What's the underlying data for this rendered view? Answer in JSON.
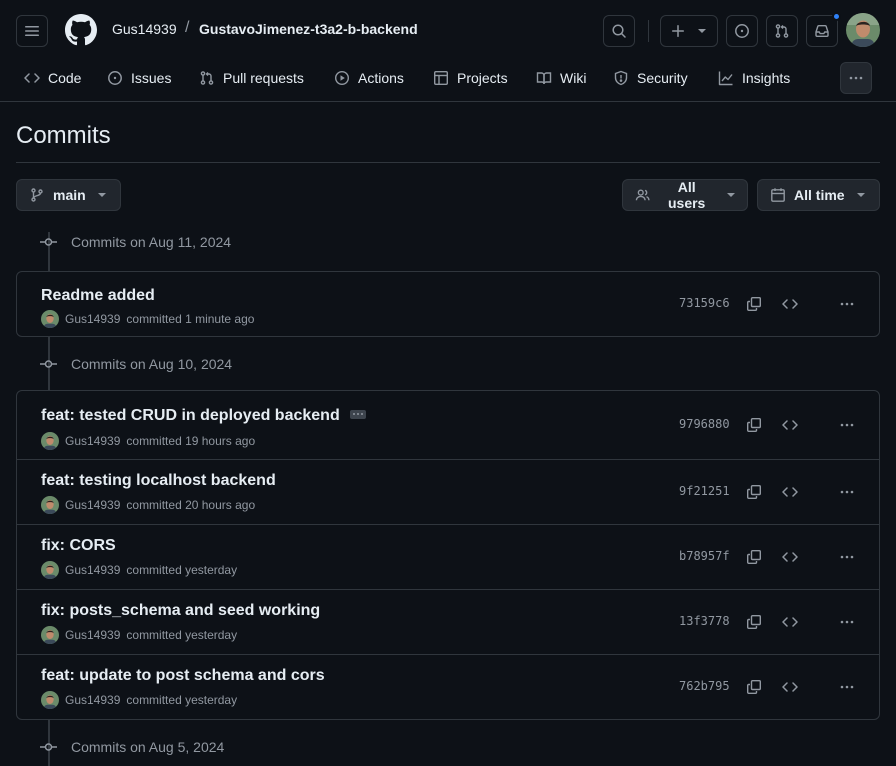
{
  "header": {
    "owner": "Gus14939",
    "separator": "/",
    "repo": "GustavoJimenez-t3a2-b-backend"
  },
  "nav": {
    "tabs": [
      {
        "label": "Code",
        "icon": "code-icon"
      },
      {
        "label": "Issues",
        "icon": "issue-opened-icon"
      },
      {
        "label": "Pull requests",
        "icon": "git-pull-request-icon"
      },
      {
        "label": "Actions",
        "icon": "play-icon"
      },
      {
        "label": "Projects",
        "icon": "table-icon"
      },
      {
        "label": "Wiki",
        "icon": "book-icon"
      },
      {
        "label": "Security",
        "icon": "shield-icon"
      },
      {
        "label": "Insights",
        "icon": "graph-icon"
      }
    ]
  },
  "page": {
    "title": "Commits"
  },
  "filters": {
    "branch": "main",
    "users": "All users",
    "time": "All time"
  },
  "groups": [
    {
      "heading": "Commits on Aug 11, 2024",
      "commits": [
        {
          "message": "Readme added",
          "author": "Gus14939",
          "when": "committed 1 minute ago",
          "sha": "73159c6"
        }
      ]
    },
    {
      "heading": "Commits on Aug 10, 2024",
      "commits": [
        {
          "message": "feat: tested CRUD in deployed backend",
          "author": "Gus14939",
          "when": "committed 19 hours ago",
          "sha": "9796880"
        },
        {
          "message": "feat: testing localhost backend",
          "author": "Gus14939",
          "when": "committed 20 hours ago",
          "sha": "9f21251"
        },
        {
          "message": "fix: CORS",
          "author": "Gus14939",
          "when": "committed yesterday",
          "sha": "b78957f"
        },
        {
          "message": "fix: posts_schema and seed working",
          "author": "Gus14939",
          "when": "committed yesterday",
          "sha": "13f3778"
        },
        {
          "message": "feat: update to post schema and cors",
          "author": "Gus14939",
          "when": "committed yesterday",
          "sha": "762b795"
        }
      ]
    },
    {
      "heading": "Commits on Aug 5, 2024",
      "commits": []
    }
  ],
  "colors": {
    "background": "#0d1117",
    "border": "#30363d",
    "muted": "#9198a1",
    "text": "#e6edf3",
    "notification": "#2f81f7"
  }
}
